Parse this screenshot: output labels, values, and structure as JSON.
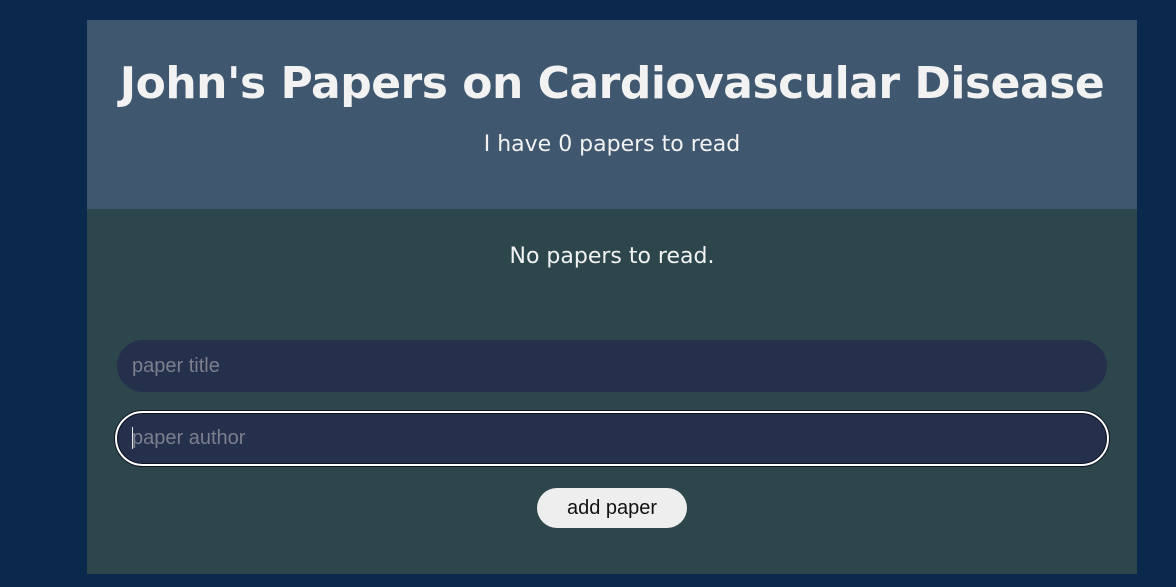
{
  "header": {
    "title": "John's Papers on Cardiovascular Disease",
    "subtitle": "I have 0 papers to read"
  },
  "main": {
    "empty_message": "No papers to read."
  },
  "form": {
    "title_placeholder": "paper title",
    "title_value": "",
    "author_placeholder": "paper author",
    "author_value": "",
    "add_label": "add paper"
  },
  "colors": {
    "page_background": "#0b284d",
    "header_background": "#40586f",
    "main_background": "#2c464c",
    "input_background": "#25304d",
    "button_background": "#eeeeee"
  }
}
